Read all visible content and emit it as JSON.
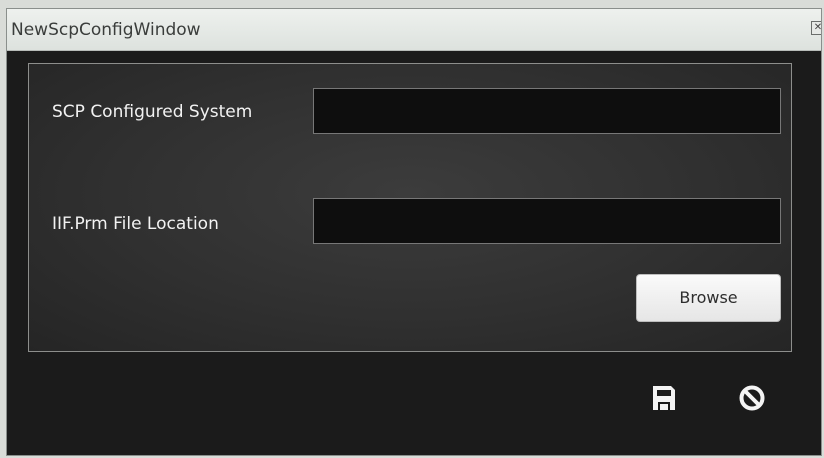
{
  "window": {
    "title": "NewScpConfigWindow"
  },
  "titlebar": {
    "close_icon": "close-icon"
  },
  "form": {
    "system_label": "SCP Configured System",
    "system_value": "",
    "file_label": "IIF.Prm File Location",
    "file_value": "",
    "browse_label": "Browse"
  },
  "footer": {
    "save_icon": "save-icon",
    "cancel_icon": "cancel-icon"
  },
  "colors": {
    "window_background": "#1b1b1b",
    "panel_background": "#303030",
    "input_background": "#0e0e0e",
    "icon_color": "#f4f4f4"
  }
}
